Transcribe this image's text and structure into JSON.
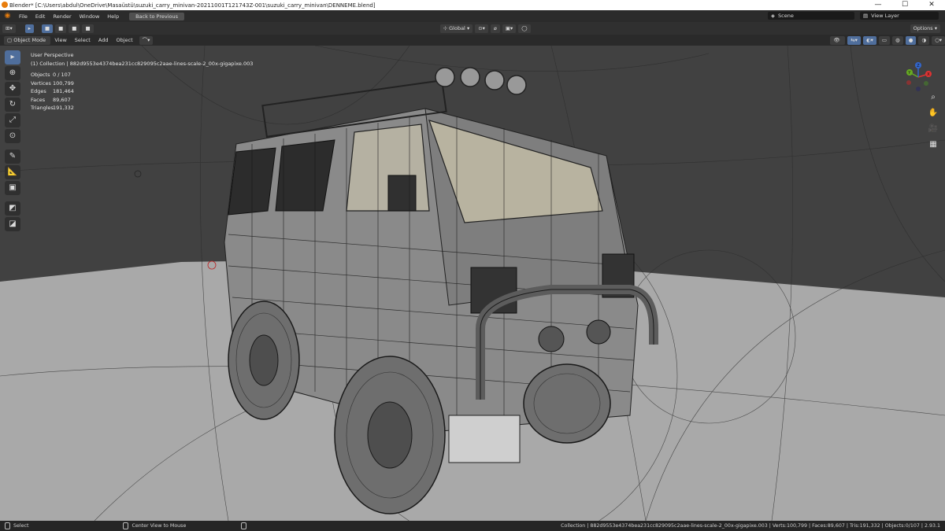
{
  "window": {
    "title": "Blender* [C:\\Users\\abdul\\OneDrive\\Masaüstü\\suzuki_carry_minivan-20211001T121743Z-001\\suzuki_carry_minivan\\DENNEME.blend]",
    "minimize": "—",
    "maximize": "☐",
    "close": "✕"
  },
  "menubar": {
    "items": [
      "File",
      "Edit",
      "Render",
      "Window",
      "Help"
    ],
    "back_button": "Back to Previous",
    "scene_label": "Scene",
    "view_layer_label": "View Layer"
  },
  "header": {
    "orientation": "Global",
    "options": "Options"
  },
  "viewport_header": {
    "mode": "Object Mode",
    "menus": [
      "View",
      "Select",
      "Add",
      "Object"
    ]
  },
  "overlay": {
    "perspective": "User Perspective",
    "collection": "(1) Collection | 882d9553e4374bea231cc829095c2aae-lines-scale-2_00x-gigapixe.003",
    "stats": [
      {
        "label": "Objects",
        "value": "0 / 107"
      },
      {
        "label": "Vertices",
        "value": "100,799"
      },
      {
        "label": "Edges",
        "value": "181,464"
      },
      {
        "label": "Faces",
        "value": "89,607"
      },
      {
        "label": "Triangles",
        "value": "191,332"
      }
    ]
  },
  "gizmo": {
    "x": "X",
    "y": "Y",
    "z": "Z"
  },
  "statusbar": {
    "select": "Select",
    "center_view": "Center View to Mouse",
    "info": "Collection | 882d9553e4374bea231cc829095c2aae-lines-scale-2_00x-gigapixe.003 | Verts:100,799 | Faces:89,607 | Tris:191,332 | Objects:0/107 | 2.93.1"
  },
  "colors": {
    "accent": "#4f6e9c",
    "brand": "#e87d0d"
  }
}
